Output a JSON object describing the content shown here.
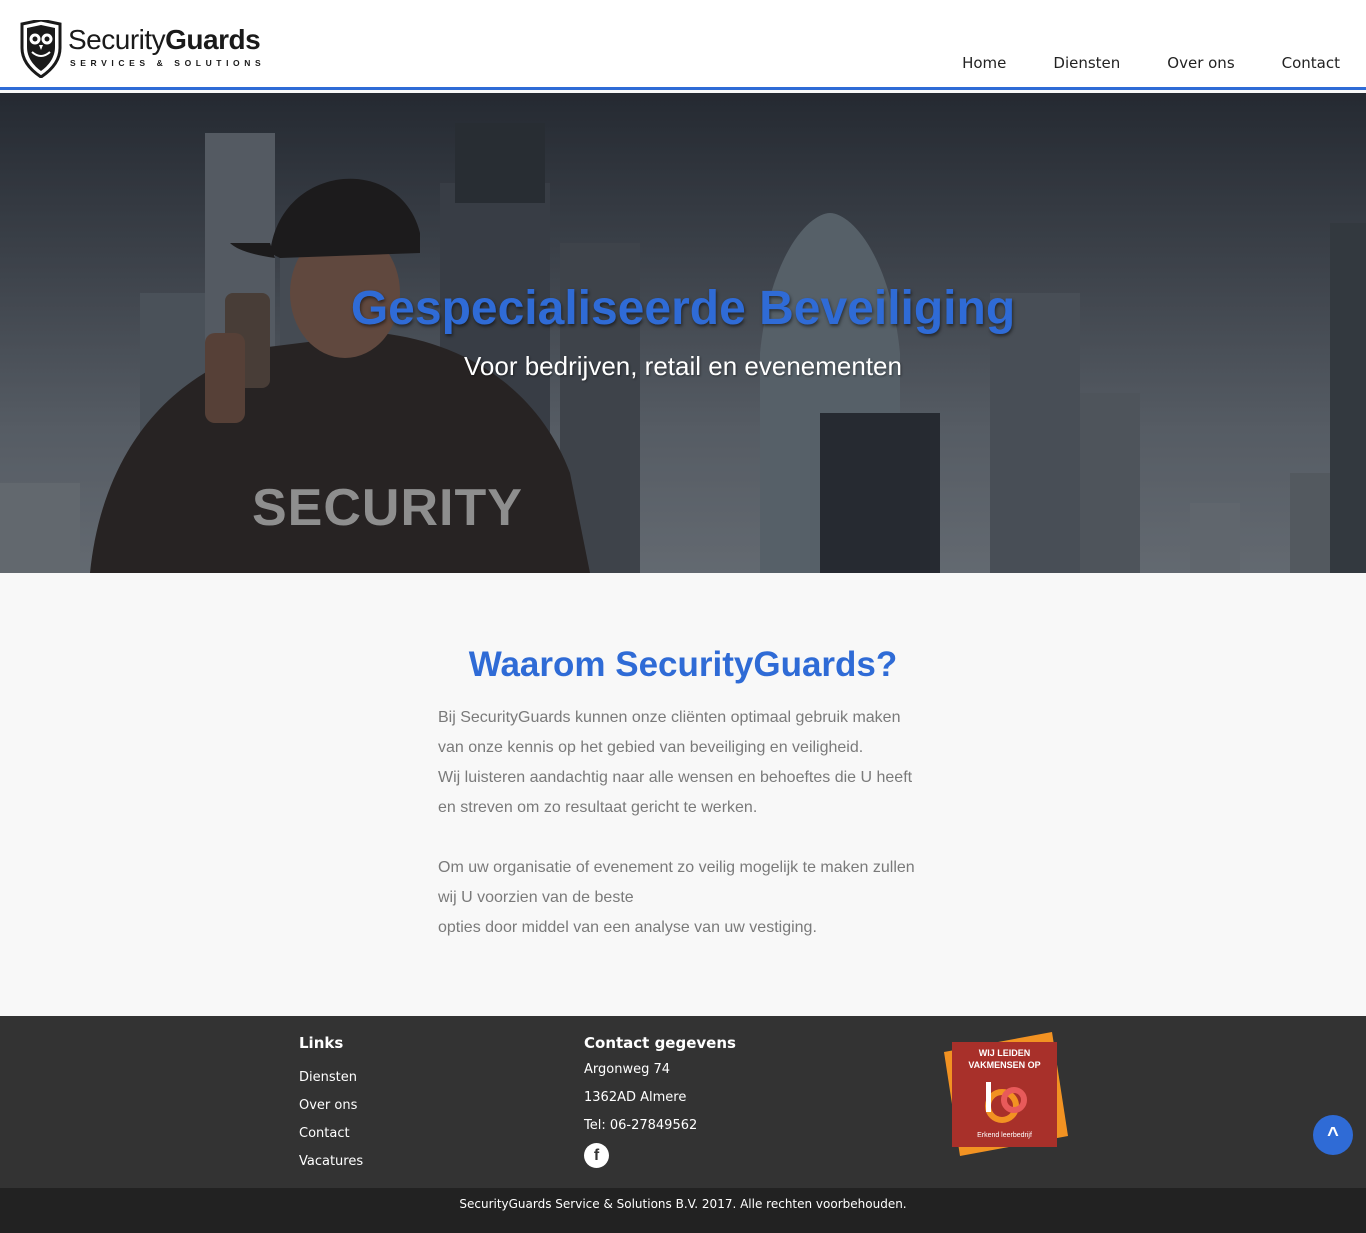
{
  "brand": {
    "name_thin": "Security",
    "name_bold": "Guards",
    "tagline": "SERVICES & SOLUTIONS"
  },
  "nav": {
    "items": [
      "Home",
      "Diensten",
      "Over ons",
      "Contact"
    ]
  },
  "hero": {
    "title": "Gespecialiseerde Beveiliging",
    "subtitle": "Voor bedrijven, retail en evenementen",
    "jacket_text": "SECURITY"
  },
  "why": {
    "title": "Waarom SecurityGuards?",
    "lines": [
      "Bij SecurityGuards kunnen onze cliënten optimaal gebruik maken",
      "van onze kennis op het gebied van beveiliging en veiligheid.",
      "Wij luisteren aandachtig naar alle wensen en behoeftes die U heeft",
      "en streven om zo resultaat gericht te werken.",
      "",
      "Om uw organisatie of evenement zo veilig mogelijk te maken zullen",
      "wij U voorzien van de beste",
      "opties door middel van een analyse van uw vestiging."
    ]
  },
  "footer": {
    "links_title": "Links",
    "links": [
      "Diensten",
      "Over ons",
      "Contact",
      "Vacatures"
    ],
    "contact_title": "Contact gegevens",
    "address": "Argonweg 74",
    "postal": "1362AD Almere",
    "phone": "Tel: 06-27849562",
    "facebook_glyph": "f",
    "badge_line1": "WIJ LEIDEN",
    "badge_line2": "VAKMENSEN OP",
    "badge_footer": "Erkend leerbedrijf",
    "copyright": "SecurityGuards Service & Solutions B.V. 2017. Alle rechten voorbehouden."
  },
  "scroll_top_glyph": "^",
  "colors": {
    "accent": "#2f6bd6",
    "footer_bg": "#333333",
    "copyright_bg": "#222222",
    "badge_red": "#a8302a",
    "badge_orange": "#f29222"
  }
}
